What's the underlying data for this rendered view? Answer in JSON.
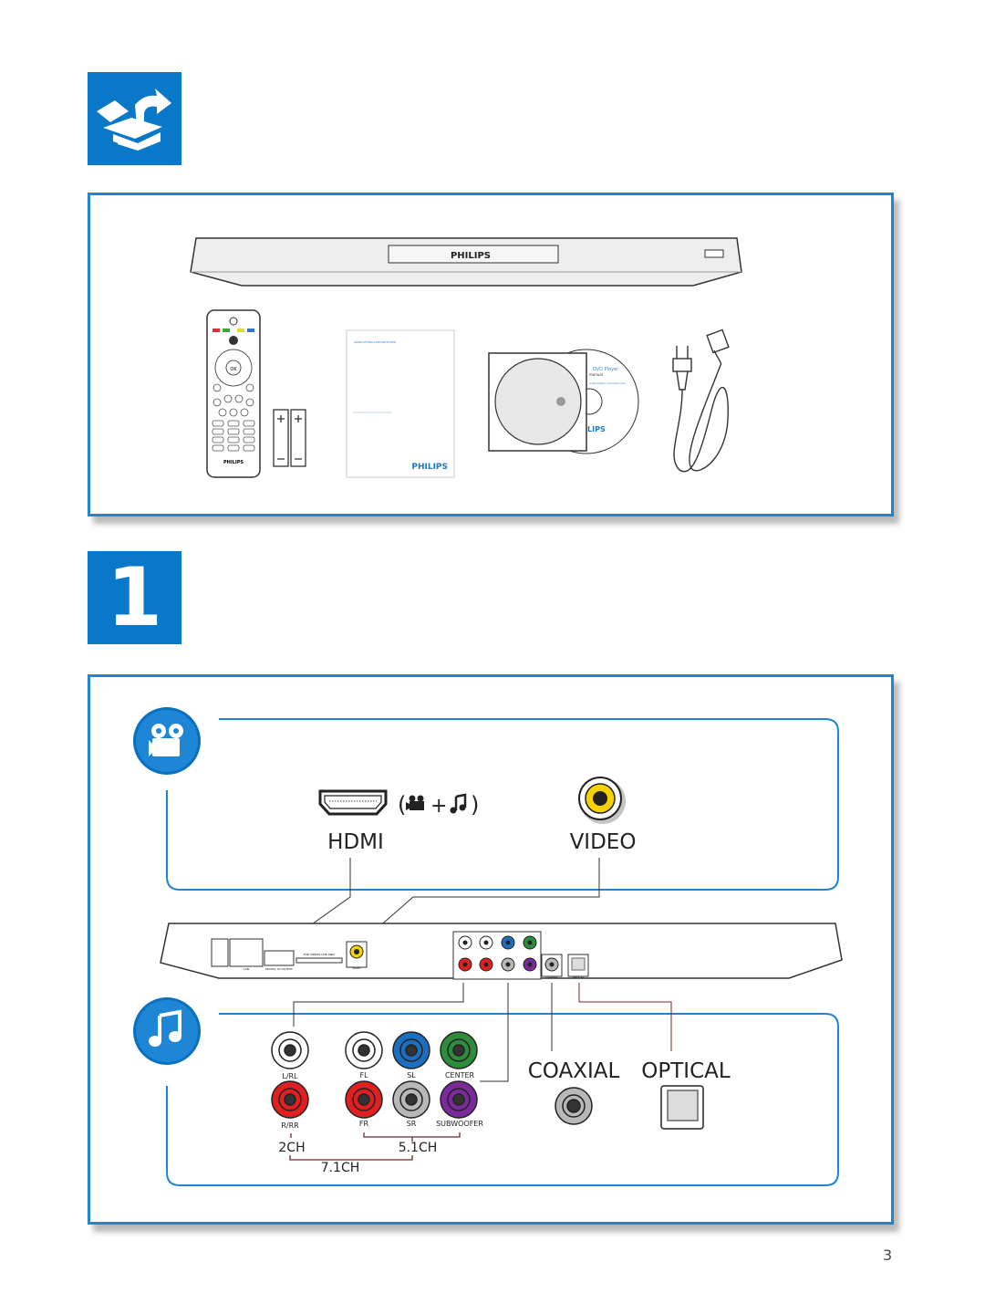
{
  "header": {
    "icon": "unpack-box-icon",
    "accent_color": "#0a78c8"
  },
  "box_contents": {
    "player": {
      "brand": "PHILIPS"
    },
    "remote": {
      "brand": "PHILIPS",
      "ok_label": "OK"
    },
    "manual": {
      "url": "www.philips.com/welcome",
      "brand": "PHILIPS"
    },
    "disc": {
      "title": "DVD Player",
      "subtitle": "manual",
      "url": "www.philips.com/welcome",
      "brand": "LIPS"
    }
  },
  "step": {
    "number": "1"
  },
  "video_section": {
    "icon": "video-camera-icon",
    "hdmi_label": "HDMI",
    "hdmi_note_open": "(",
    "hdmi_note_plus": "+",
    "hdmi_note_close": ")",
    "video_label": "VIDEO"
  },
  "rear_panel": {
    "lan": "LAN",
    "digital_av": "DIGITAL AV OUTPUT",
    "bd_live": "FOR VIDEOS-LIVE ONLY",
    "video": "VIDEO",
    "coaxial": "COAXIAL",
    "optical": "OPTICAL"
  },
  "audio_section": {
    "icon": "music-note-icon",
    "connectors": {
      "lrl": "L/RL",
      "rrr": "R/RR",
      "fl": "FL",
      "fr": "FR",
      "sl": "SL",
      "sr": "SR",
      "center": "CENTER",
      "subwoofer": "SUBWOOFER"
    },
    "ch2": "2CH",
    "ch51": "5.1CH",
    "ch71": "7.1CH",
    "coaxial_label": "COAXIAL",
    "optical_label": "OPTICAL"
  },
  "colors": {
    "white": "#ffffff",
    "red": "#e02020",
    "blue": "#1e6ec0",
    "green": "#2e8c3c",
    "gray": "#b8b8b8",
    "purple": "#7a2a9a",
    "yellow": "#f5d200"
  },
  "page_number": "3"
}
